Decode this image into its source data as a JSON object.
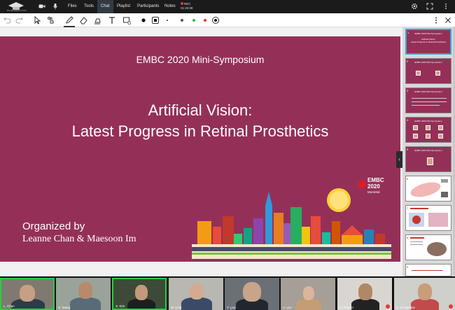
{
  "app": {
    "logo_text": "BIGBLUEBUTTON",
    "colors": {
      "topbar": "#1b1b1b",
      "active_tab": "#333b44",
      "slide_bg": "#943058",
      "talking": "#2ecc40",
      "record": "#e53935",
      "thumb_selected": "#35a6d6"
    }
  },
  "topbar": {
    "items": [
      {
        "label": "Files"
      },
      {
        "label": "Tools"
      },
      {
        "label": "Chat"
      },
      {
        "label": "Playlist"
      },
      {
        "label": "Participants"
      },
      {
        "label": "Notes"
      }
    ],
    "active_item": "Chat",
    "record": {
      "label": "REC",
      "time": "01:26:08"
    },
    "icons": [
      "camera-icon",
      "microphone-icon",
      "gear-icon",
      "fullscreen-icon",
      "more-vertical-icon"
    ]
  },
  "toolbar": {
    "tools": [
      "undo-icon",
      "redo-icon",
      "select-arrow-icon",
      "hand-pointer-icon",
      "pencil-icon",
      "eraser-icon",
      "highlighter-icon",
      "text-icon",
      "shape-icon",
      "fill-dot-icon",
      "square-stroke-icon",
      "small-dot-icon",
      "color-purple",
      "color-green",
      "color-red",
      "target-icon"
    ],
    "selected_tool": "pencil-icon",
    "color_swatches": [
      "#6a3fa8",
      "#3cb043",
      "#e53935"
    ],
    "right_icons": [
      "more-vertical-icon",
      "close-icon"
    ]
  },
  "slide": {
    "symposium": "EMBC 2020 Mini-Symposium",
    "title_line1": "Artificial Vision:",
    "title_line2": "Latest Progress in Retinal Prosthetics",
    "organized_by": "Organized by",
    "organizers": "Leanne Chan & Maesoon Im",
    "embc_logo": {
      "line1": "EMBC",
      "line2": "2020",
      "line3": "Montréal"
    }
  },
  "thumbnails": {
    "selected": 1,
    "items": [
      {
        "num": "1",
        "style": "maroon",
        "text1": "EMBC 2020 Mini-Symposium",
        "text2": "Artificial Vision:",
        "text3": "Latest Progress in Retinal Prosthetics"
      },
      {
        "num": "2",
        "style": "maroon",
        "text1": "EMBC 2020 Mini-Symposium"
      },
      {
        "num": "3",
        "style": "maroon",
        "text1": "EMBC 2020 Mini-Symposium"
      },
      {
        "num": "4",
        "style": "maroon",
        "text1": "EMBC 2020 Mini-Symposium"
      },
      {
        "num": "5",
        "style": "maroon",
        "text1": "EMBC 2020 Mini-Symposium"
      },
      {
        "num": "6",
        "style": "white"
      },
      {
        "num": "7",
        "style": "white"
      },
      {
        "num": "8",
        "style": "white"
      },
      {
        "num": "9",
        "style": "white"
      }
    ]
  },
  "participants": [
    {
      "name": "L. Chan",
      "talking": true,
      "muted": false
    },
    {
      "name": "S. Wang",
      "talking": false,
      "muted": false
    },
    {
      "name": "S. Kim",
      "talking": true,
      "muted": false
    },
    {
      "name": "M. Kiral",
      "talking": false,
      "muted": false
    },
    {
      "name": "T. Lee",
      "talking": false,
      "muted": false
    },
    {
      "name": "A. Lim",
      "talking": false,
      "muted": false
    },
    {
      "name": "D. Ghezzi",
      "talking": false,
      "muted": true
    },
    {
      "name": "E. Fernandez",
      "talking": false,
      "muted": true
    }
  ]
}
